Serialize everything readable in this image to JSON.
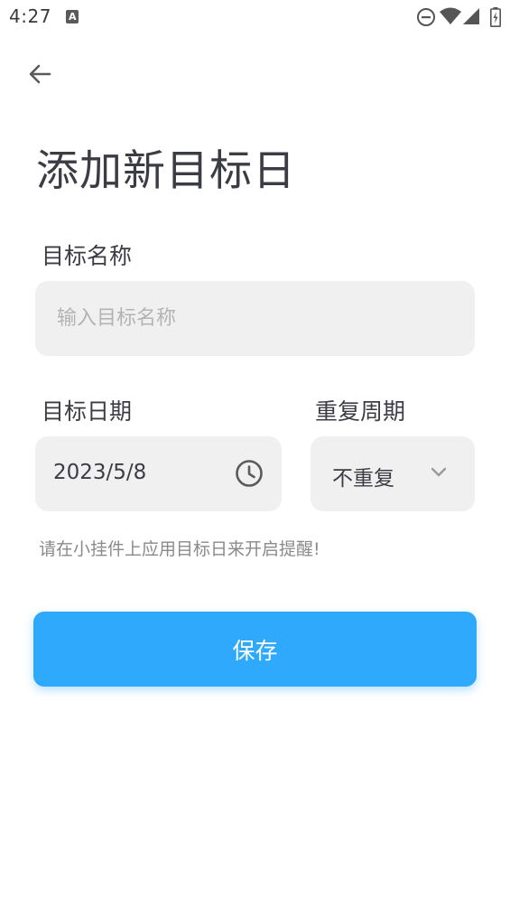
{
  "status_bar": {
    "time": "4:27",
    "notification_icon": "a-icon",
    "right_icons": [
      "do-not-disturb-icon",
      "wifi-icon",
      "signal-icon",
      "battery-charging-icon"
    ]
  },
  "header": {
    "back_icon": "arrow-left-icon",
    "title": "添加新目标日"
  },
  "form": {
    "name": {
      "label": "目标名称",
      "value": "",
      "placeholder": "输入目标名称"
    },
    "date": {
      "label": "目标日期",
      "value": "2023/5/8",
      "icon": "clock-icon"
    },
    "repeat": {
      "label": "重复周期",
      "value": "不重复",
      "icon": "chevron-down-icon"
    },
    "hint": "请在小挂件上应用目标日来开启提醒!"
  },
  "actions": {
    "save_label": "保存"
  },
  "colors": {
    "accent": "#2fa9fb",
    "field_bg": "#f0f0f0",
    "text": "#3c3d44",
    "hint": "#8a8a8a"
  }
}
